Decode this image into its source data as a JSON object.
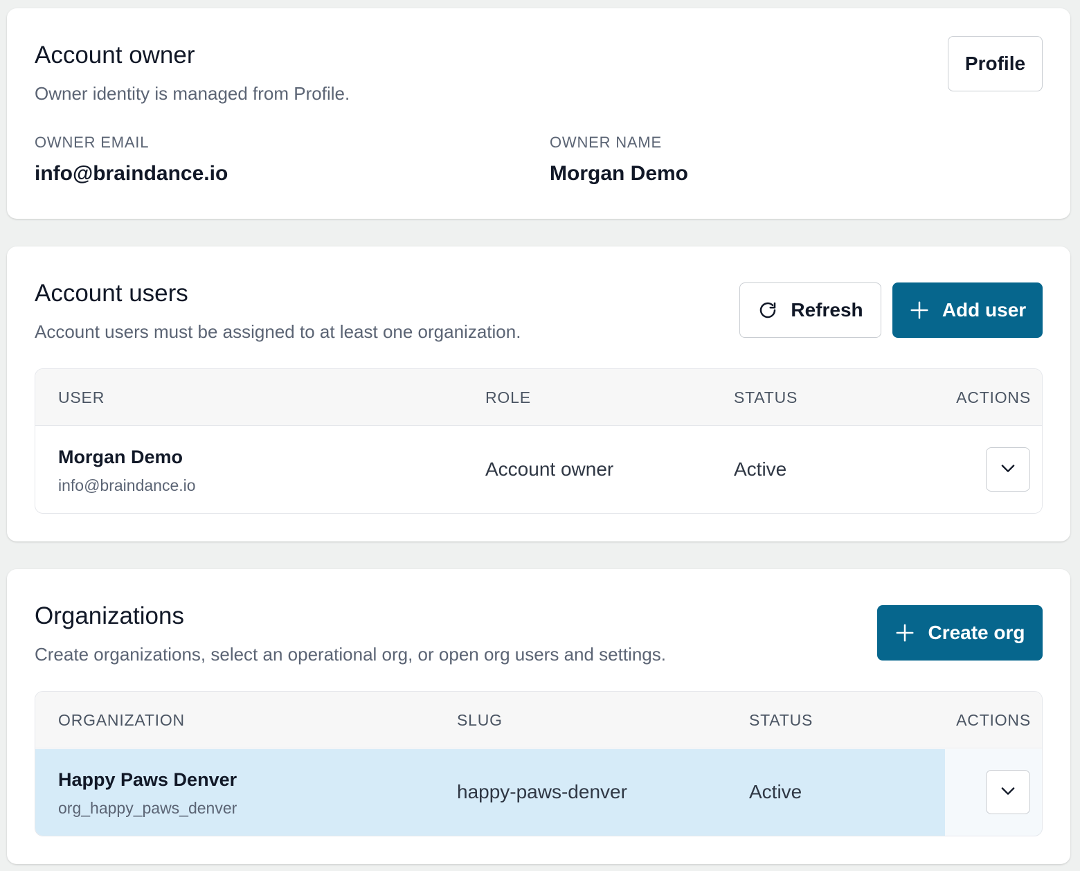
{
  "owner": {
    "title": "Account owner",
    "description": "Owner identity is managed from Profile.",
    "profile_button": "Profile",
    "email_label": "OWNER EMAIL",
    "email_value": "info@braindance.io",
    "name_label": "OWNER NAME",
    "name_value": "Morgan Demo"
  },
  "users": {
    "title": "Account users",
    "description": "Account users must be assigned to at least one organization.",
    "refresh_button": "Refresh",
    "add_button": "Add user",
    "columns": [
      "USER",
      "ROLE",
      "STATUS",
      "ACTIONS"
    ],
    "rows": [
      {
        "name": "Morgan Demo",
        "email": "info@braindance.io",
        "role": "Account owner",
        "status": "Active"
      }
    ]
  },
  "orgs": {
    "title": "Organizations",
    "description": "Create organizations, select an operational org, or open org users and settings.",
    "create_button": "Create org",
    "columns": [
      "ORGANIZATION",
      "SLUG",
      "STATUS",
      "ACTIONS"
    ],
    "rows": [
      {
        "name": "Happy Paws Denver",
        "id": "org_happy_paws_denver",
        "slug": "happy-paws-denver",
        "status": "Active",
        "selected": true
      }
    ]
  },
  "colors": {
    "primary": "#06668d",
    "selected_row": "#d6ebf8",
    "page_bg": "#eff1f0"
  },
  "icons": [
    "refresh-icon",
    "plus-icon",
    "chevron-down-icon"
  ]
}
